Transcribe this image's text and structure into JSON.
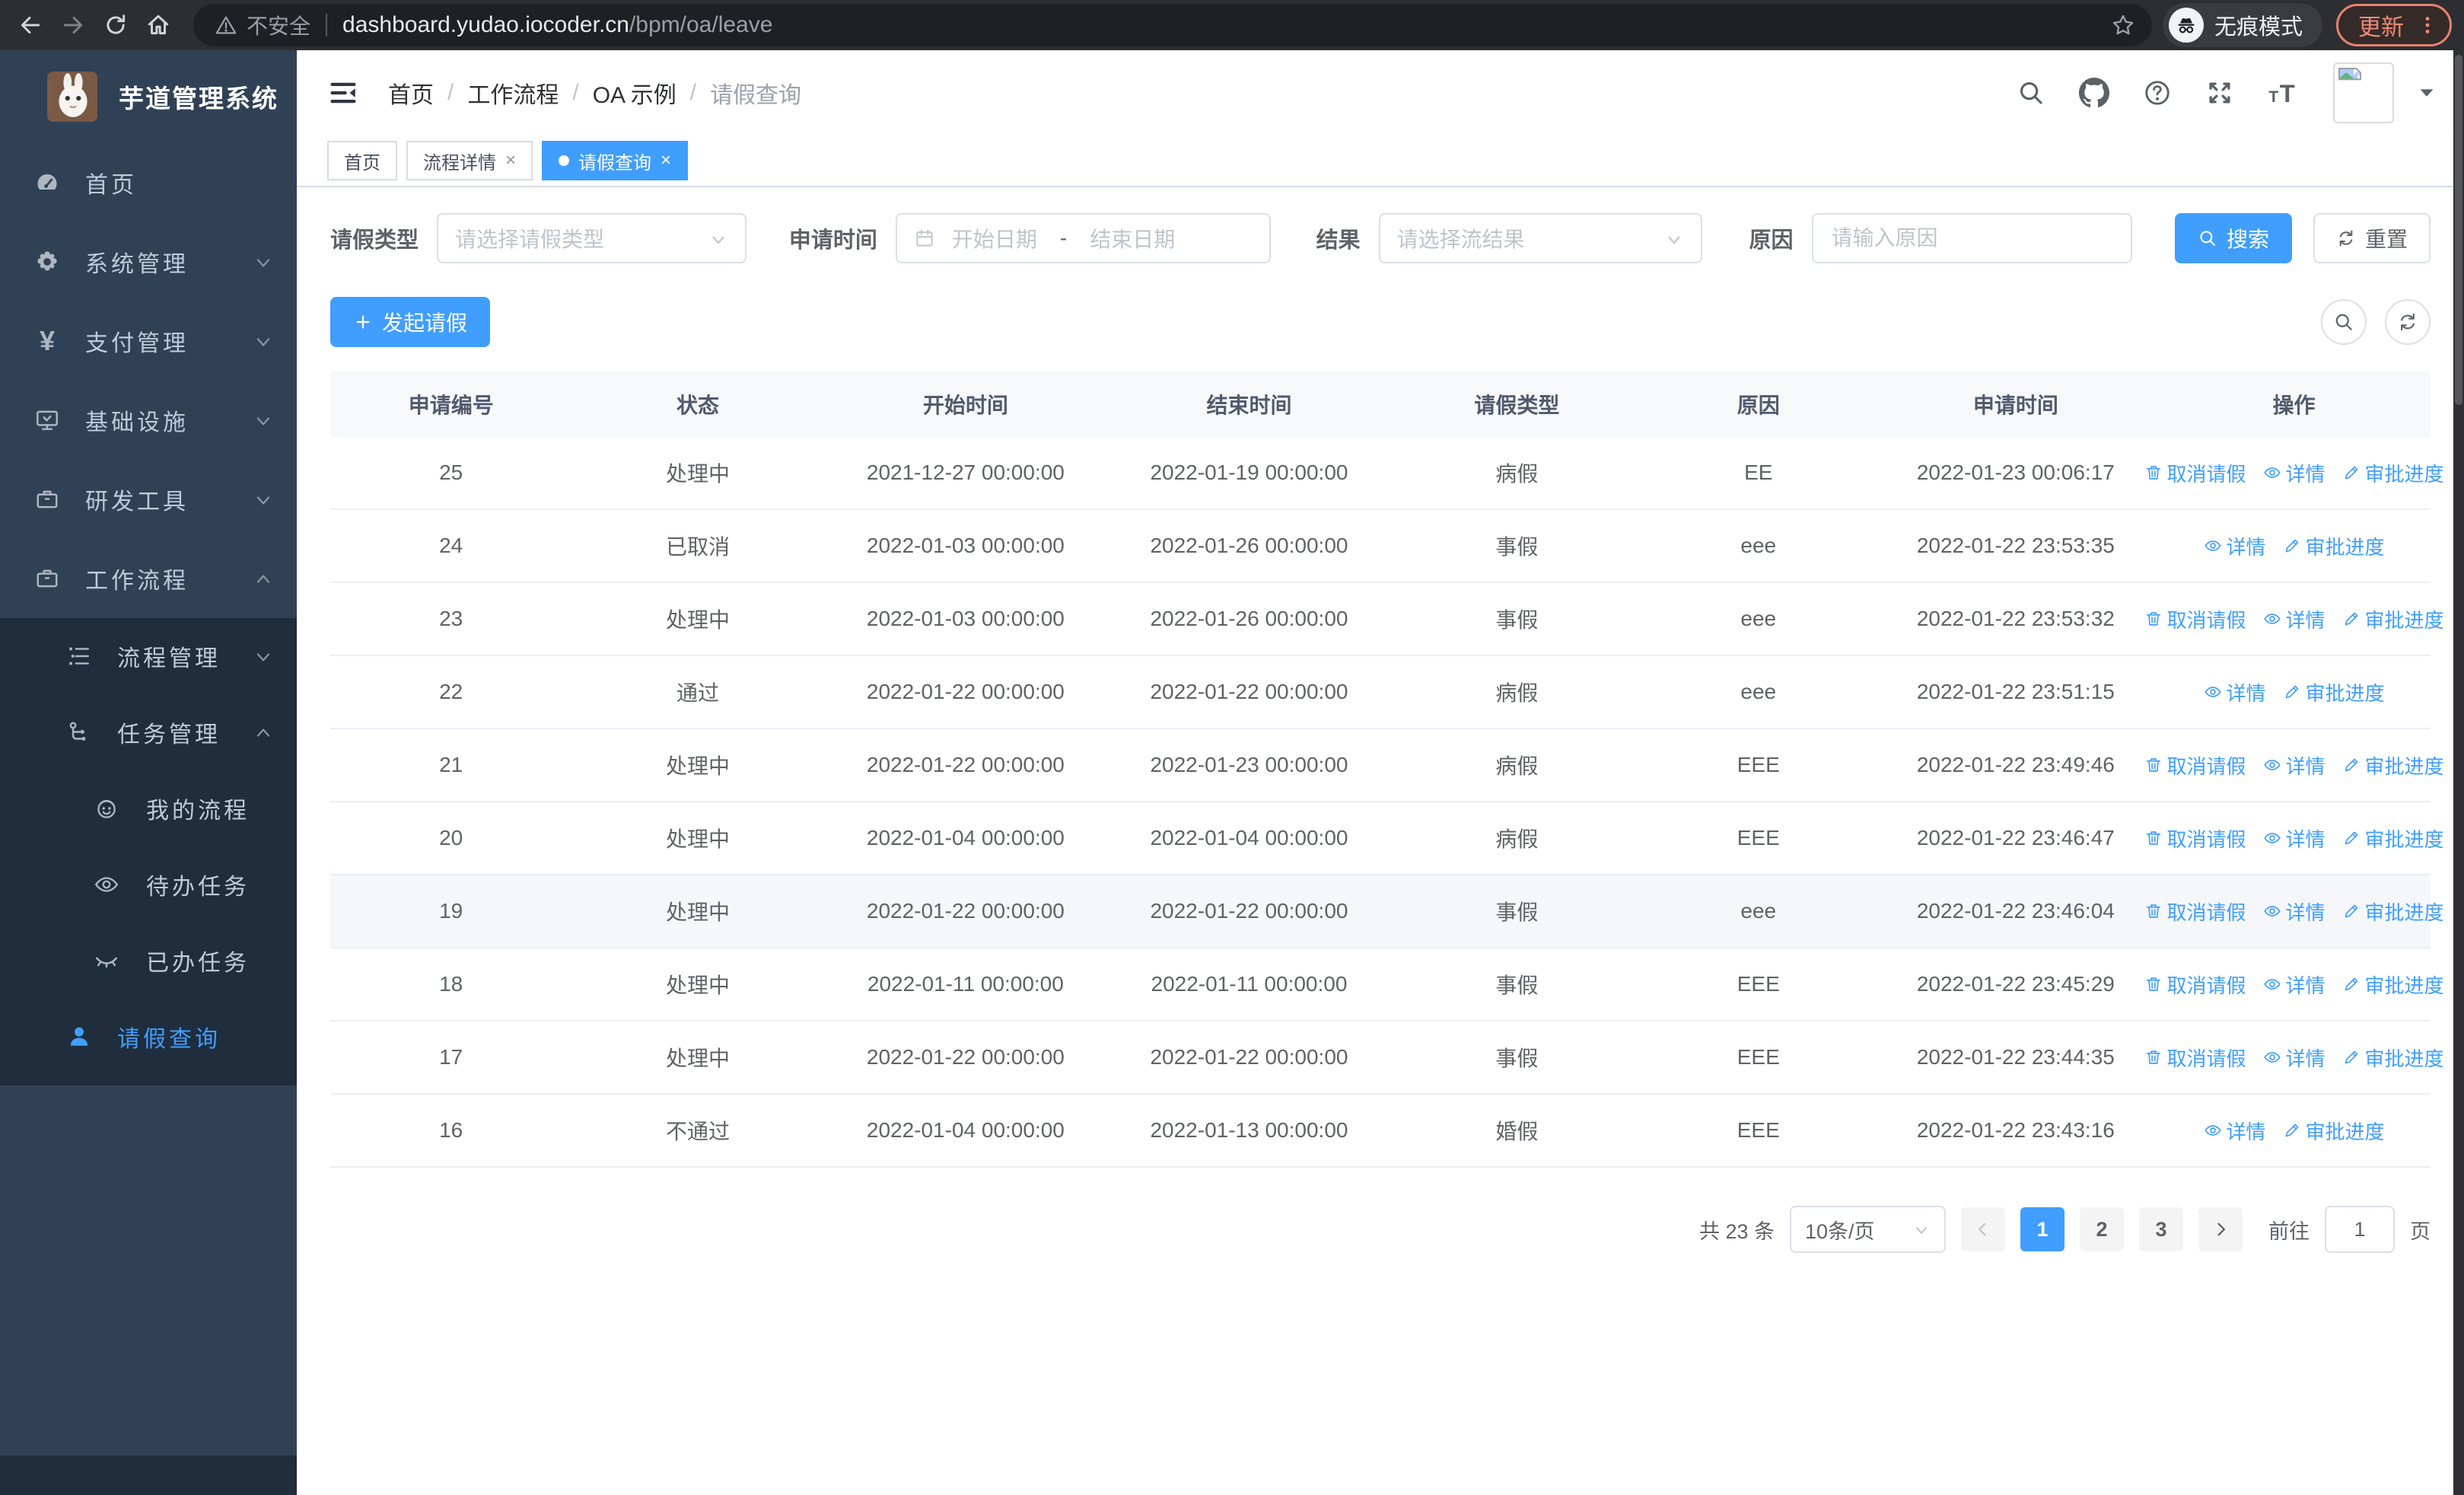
{
  "browser": {
    "security_label": "不安全",
    "url_host": "dashboard.yudao.iocoder.cn",
    "url_path": "/bpm/oa/leave",
    "incognito_label": "无痕模式",
    "update_label": "更新"
  },
  "sidebar": {
    "title": "芋道管理系统",
    "items": [
      {
        "label": "首页"
      },
      {
        "label": "系统管理"
      },
      {
        "label": "支付管理"
      },
      {
        "label": "基础设施"
      },
      {
        "label": "研发工具"
      },
      {
        "label": "工作流程"
      },
      {
        "label": "流程管理"
      },
      {
        "label": "任务管理"
      },
      {
        "label": "我的流程"
      },
      {
        "label": "待办任务"
      },
      {
        "label": "已办任务"
      },
      {
        "label": "请假查询"
      }
    ]
  },
  "breadcrumb": {
    "items": [
      "首页",
      "工作流程",
      "OA 示例",
      "请假查询"
    ]
  },
  "tabs": [
    {
      "label": "首页"
    },
    {
      "label": "流程详情"
    },
    {
      "label": "请假查询"
    }
  ],
  "filters": {
    "leave_type_label": "请假类型",
    "leave_type_placeholder": "请选择请假类型",
    "apply_time_label": "申请时间",
    "date_start_placeholder": "开始日期",
    "date_separator": "-",
    "date_end_placeholder": "结束日期",
    "result_label": "结果",
    "result_placeholder": "请选择流结果",
    "reason_label": "原因",
    "reason_placeholder": "请输入原因",
    "search_label": "搜索",
    "reset_label": "重置"
  },
  "toolbar": {
    "create_label": "发起请假"
  },
  "table": {
    "columns": [
      "申请编号",
      "状态",
      "开始时间",
      "结束时间",
      "请假类型",
      "原因",
      "申请时间",
      "操作"
    ],
    "action_labels": {
      "cancel": "取消请假",
      "detail": "详情",
      "progress": "审批进度"
    },
    "rows": [
      {
        "id": "25",
        "status": "处理中",
        "start": "2021-12-27 00:00:00",
        "end": "2022-01-19 00:00:00",
        "type": "病假",
        "reason": "EE",
        "applied": "2022-01-23 00:06:17",
        "actions": [
          "cancel",
          "detail",
          "progress"
        ],
        "highlight": false
      },
      {
        "id": "24",
        "status": "已取消",
        "start": "2022-01-03 00:00:00",
        "end": "2022-01-26 00:00:00",
        "type": "事假",
        "reason": "eee",
        "applied": "2022-01-22 23:53:35",
        "actions": [
          "detail",
          "progress"
        ],
        "highlight": false
      },
      {
        "id": "23",
        "status": "处理中",
        "start": "2022-01-03 00:00:00",
        "end": "2022-01-26 00:00:00",
        "type": "事假",
        "reason": "eee",
        "applied": "2022-01-22 23:53:32",
        "actions": [
          "cancel",
          "detail",
          "progress"
        ],
        "highlight": false
      },
      {
        "id": "22",
        "status": "通过",
        "start": "2022-01-22 00:00:00",
        "end": "2022-01-22 00:00:00",
        "type": "病假",
        "reason": "eee",
        "applied": "2022-01-22 23:51:15",
        "actions": [
          "detail",
          "progress"
        ],
        "highlight": false
      },
      {
        "id": "21",
        "status": "处理中",
        "start": "2022-01-22 00:00:00",
        "end": "2022-01-23 00:00:00",
        "type": "病假",
        "reason": "EEE",
        "applied": "2022-01-22 23:49:46",
        "actions": [
          "cancel",
          "detail",
          "progress"
        ],
        "highlight": false
      },
      {
        "id": "20",
        "status": "处理中",
        "start": "2022-01-04 00:00:00",
        "end": "2022-01-04 00:00:00",
        "type": "病假",
        "reason": "EEE",
        "applied": "2022-01-22 23:46:47",
        "actions": [
          "cancel",
          "detail",
          "progress"
        ],
        "highlight": false
      },
      {
        "id": "19",
        "status": "处理中",
        "start": "2022-01-22 00:00:00",
        "end": "2022-01-22 00:00:00",
        "type": "事假",
        "reason": "eee",
        "applied": "2022-01-22 23:46:04",
        "actions": [
          "cancel",
          "detail",
          "progress"
        ],
        "highlight": true
      },
      {
        "id": "18",
        "status": "处理中",
        "start": "2022-01-11 00:00:00",
        "end": "2022-01-11 00:00:00",
        "type": "事假",
        "reason": "EEE",
        "applied": "2022-01-22 23:45:29",
        "actions": [
          "cancel",
          "detail",
          "progress"
        ],
        "highlight": false
      },
      {
        "id": "17",
        "status": "处理中",
        "start": "2022-01-22 00:00:00",
        "end": "2022-01-22 00:00:00",
        "type": "事假",
        "reason": "EEE",
        "applied": "2022-01-22 23:44:35",
        "actions": [
          "cancel",
          "detail",
          "progress"
        ],
        "highlight": false
      },
      {
        "id": "16",
        "status": "不通过",
        "start": "2022-01-04 00:00:00",
        "end": "2022-01-13 00:00:00",
        "type": "婚假",
        "reason": "EEE",
        "applied": "2022-01-22 23:43:16",
        "actions": [
          "detail",
          "progress"
        ],
        "highlight": false
      }
    ]
  },
  "pagination": {
    "total_label": "共 23 条",
    "page_size_label": "10条/页",
    "pages": [
      "1",
      "2",
      "3"
    ],
    "goto_label": "前往",
    "goto_value": "1",
    "goto_unit": "页"
  },
  "colors": {
    "primary": "#409eff",
    "sidebar_bg": "#304156",
    "submenu_bg": "#1f2d3d"
  }
}
